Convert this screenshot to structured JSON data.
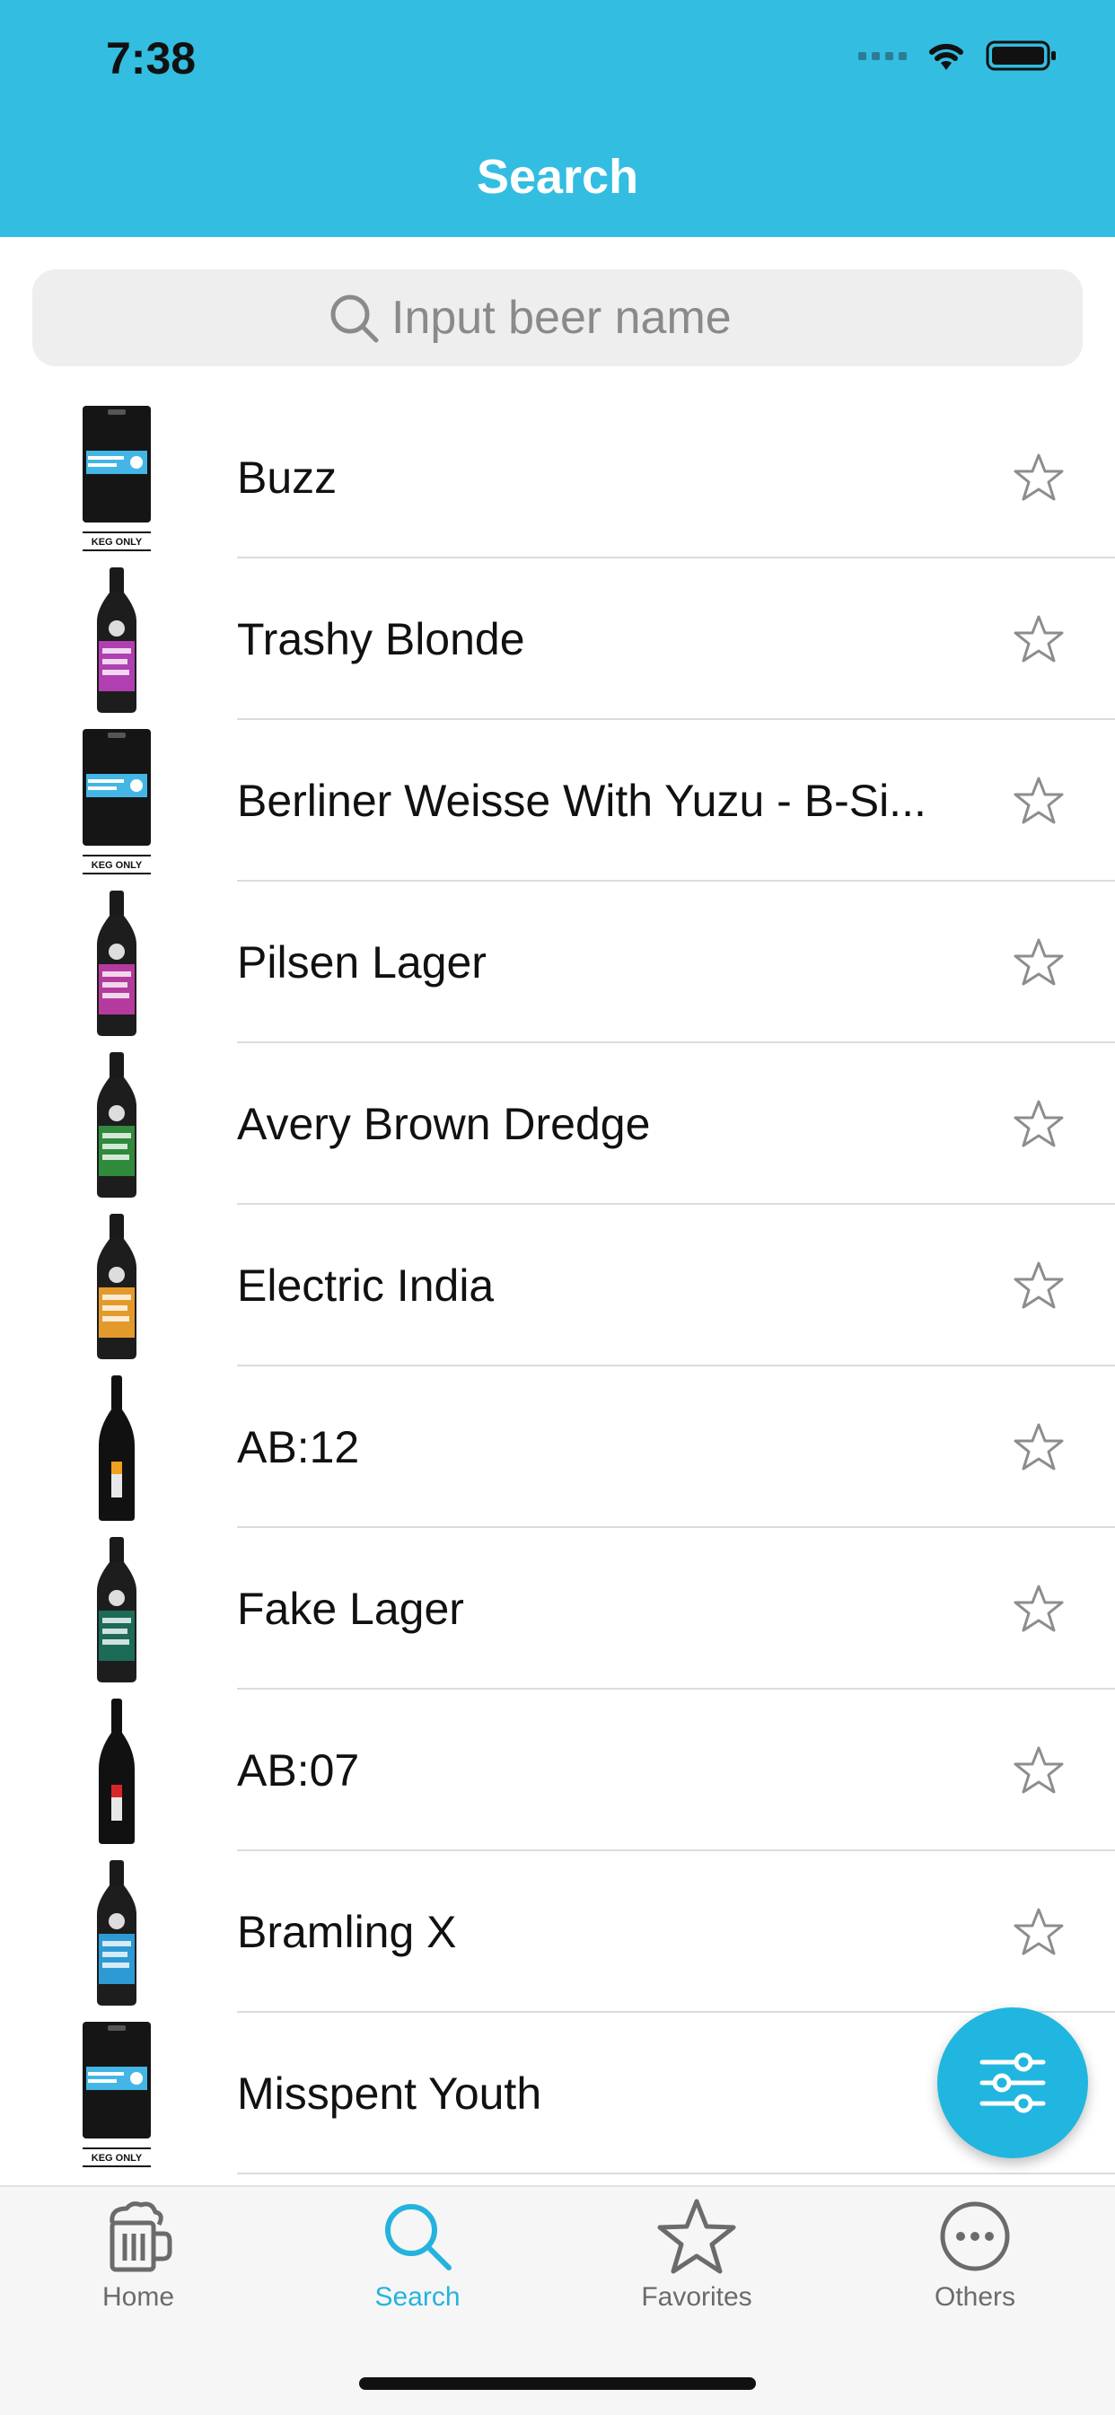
{
  "status": {
    "time": "7:38"
  },
  "nav": {
    "title": "Search"
  },
  "search": {
    "placeholder": "Input beer name"
  },
  "beers": [
    {
      "name": "Buzz",
      "image": "keg"
    },
    {
      "name": "Trashy Blonde",
      "image": "bottle-purple"
    },
    {
      "name": "Berliner Weisse With Yuzu - B-Si...",
      "image": "keg"
    },
    {
      "name": "Pilsen Lager",
      "image": "bottle-magenta"
    },
    {
      "name": "Avery Brown Dredge",
      "image": "bottle-green"
    },
    {
      "name": "Electric India",
      "image": "bottle-orange"
    },
    {
      "name": "AB:12",
      "image": "champagne-orange"
    },
    {
      "name": "Fake Lager",
      "image": "bottle-teal"
    },
    {
      "name": "AB:07",
      "image": "champagne-red"
    },
    {
      "name": "Bramling X",
      "image": "bottle-blue"
    },
    {
      "name": "Misspent Youth",
      "image": "keg"
    }
  ],
  "keg_label": "KEG ONLY",
  "tabs": [
    {
      "label": "Home",
      "icon": "beer-mug-icon"
    },
    {
      "label": "Search",
      "icon": "search-icon"
    },
    {
      "label": "Favorites",
      "icon": "star-icon"
    },
    {
      "label": "Others",
      "icon": "more-icon"
    }
  ],
  "colors": {
    "accent": "#33bde1",
    "fab": "#20b6df",
    "active_tab": "#25b3dd"
  }
}
